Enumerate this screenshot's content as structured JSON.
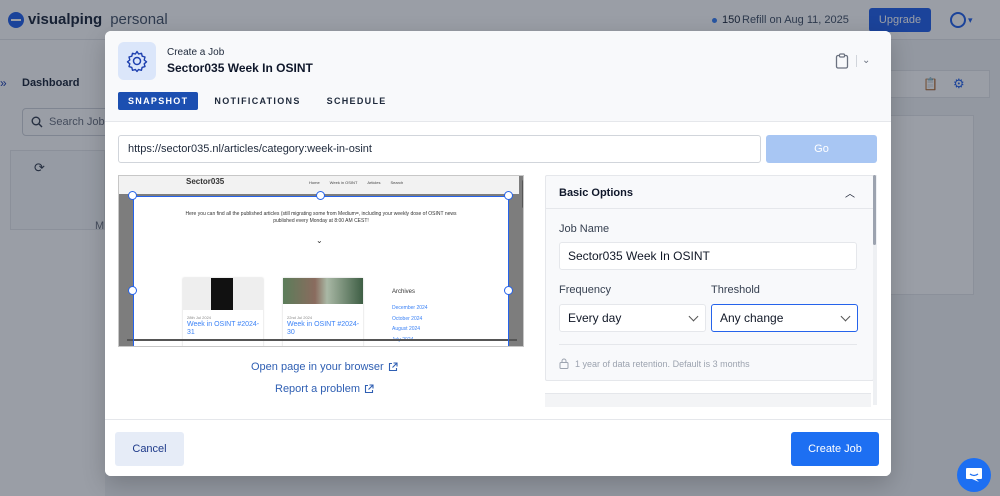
{
  "app": {
    "logo_text": "visualping",
    "plan": "personal",
    "credits": "150",
    "refill": "Refill on Aug 11, 2025",
    "upgrade_label": "Upgrade"
  },
  "sidebar": {
    "title": "Dashboard",
    "search_placeholder": "Search Job",
    "empty_initial": "M"
  },
  "modal": {
    "subtitle": "Create a Job",
    "title": "Sector035 Week In OSINT",
    "tabs": [
      {
        "label": "SNAPSHOT",
        "active": true
      },
      {
        "label": "NOTIFICATIONS",
        "active": false
      },
      {
        "label": "SCHEDULE",
        "active": false
      }
    ],
    "url": "https://sector035.nl/articles/category:week-in-osint",
    "go_label": "Go",
    "preview": {
      "brand": "Sector035",
      "nav": [
        "Home",
        "Week in OSINT",
        "Articles",
        "Search"
      ],
      "intro": "Here you can find all the published articles (still migrating some from Medium=, including your weekly dose of OSINT news published every Monday at 8:00 AM CEST!",
      "cards": [
        {
          "date": "28th Jul 2024",
          "title": "Week in OSINT #2024-31"
        },
        {
          "date": "22nd Jul 2024",
          "title": "Week in OSINT #2024-30"
        }
      ],
      "archives_title": "Archives",
      "archives": [
        "December 2024",
        "October 2024",
        "August 2024",
        "July 2024"
      ]
    },
    "open_link": "Open page in your browser",
    "report_link": "Report a problem",
    "options": {
      "title": "Basic Options",
      "job_name_label": "Job Name",
      "job_name_value": "Sector035 Week In OSINT",
      "frequency_label": "Frequency",
      "frequency_value": "Every day",
      "threshold_label": "Threshold",
      "threshold_value": "Any change",
      "retention_note": "1 year of data retention. Default is 3 months"
    },
    "cancel_label": "Cancel",
    "create_label": "Create Job"
  }
}
